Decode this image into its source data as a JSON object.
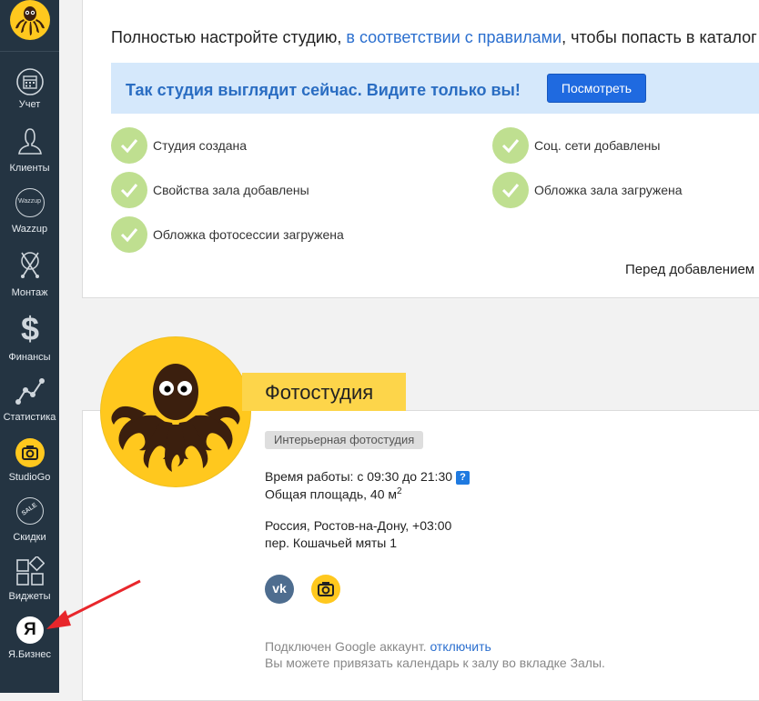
{
  "sidebar": {
    "items": [
      {
        "label": "Учет",
        "icon": "calendar-icon"
      },
      {
        "label": "Клиенты",
        "icon": "client-icon"
      },
      {
        "label": "Wazzup",
        "icon": "wazzup-icon",
        "icon_text": "Wazzup"
      },
      {
        "label": "Монтаж",
        "icon": "montage-icon"
      },
      {
        "label": "Финансы",
        "icon": "dollar-icon",
        "icon_text": "$"
      },
      {
        "label": "Статистика",
        "icon": "statistics-icon"
      },
      {
        "label": "StudioGo",
        "icon": "studiogo-camera-icon"
      },
      {
        "label": "Скидки",
        "icon": "sale-tag-icon",
        "icon_text": "SALE"
      },
      {
        "label": "Виджеты",
        "icon": "widgets-icon"
      },
      {
        "label": "Я.Бизнес",
        "icon": "yandex-icon",
        "icon_text": "Я"
      }
    ]
  },
  "top": {
    "intro_before": "Полностью настройте студию, ",
    "intro_link": "в соответствии с правилами",
    "intro_after": ", чтобы попасть в каталог",
    "banner_text": "Так студия выглядит сейчас. Видите только вы!",
    "banner_button": "Посмотреть",
    "checks": [
      "Студия создана",
      "Соц. сети добавлены",
      "Свойства зала добавлены",
      "Обложка зала загружена",
      "Обложка фотосессии загружена"
    ],
    "before_text": "Перед добавлением"
  },
  "studio": {
    "title": "Фотостудия",
    "tag": "Интерьерная фотостудия",
    "hours": "Время работы: с 09:30 до 21:30",
    "help": "?",
    "area": "Общая площадь, 40 м",
    "area_sup": "2",
    "location": "Россия, Ростов-на-Дону, +03:00",
    "street": "пер. Кошачьей мяты 1",
    "vk": "vk",
    "google_text": "Подключен Google аккаунт. ",
    "google_link": "отключить",
    "calendar_text": "Вы можете привязать календарь к залу во вкладке Залы."
  },
  "colors": {
    "sidebar_bg": "#243442",
    "accent_yellow": "#ffc81e",
    "link_blue": "#2b6fcf",
    "button_blue": "#1f6ae0",
    "check_green": "#bfdf90",
    "annotation_red": "#e8262b"
  }
}
